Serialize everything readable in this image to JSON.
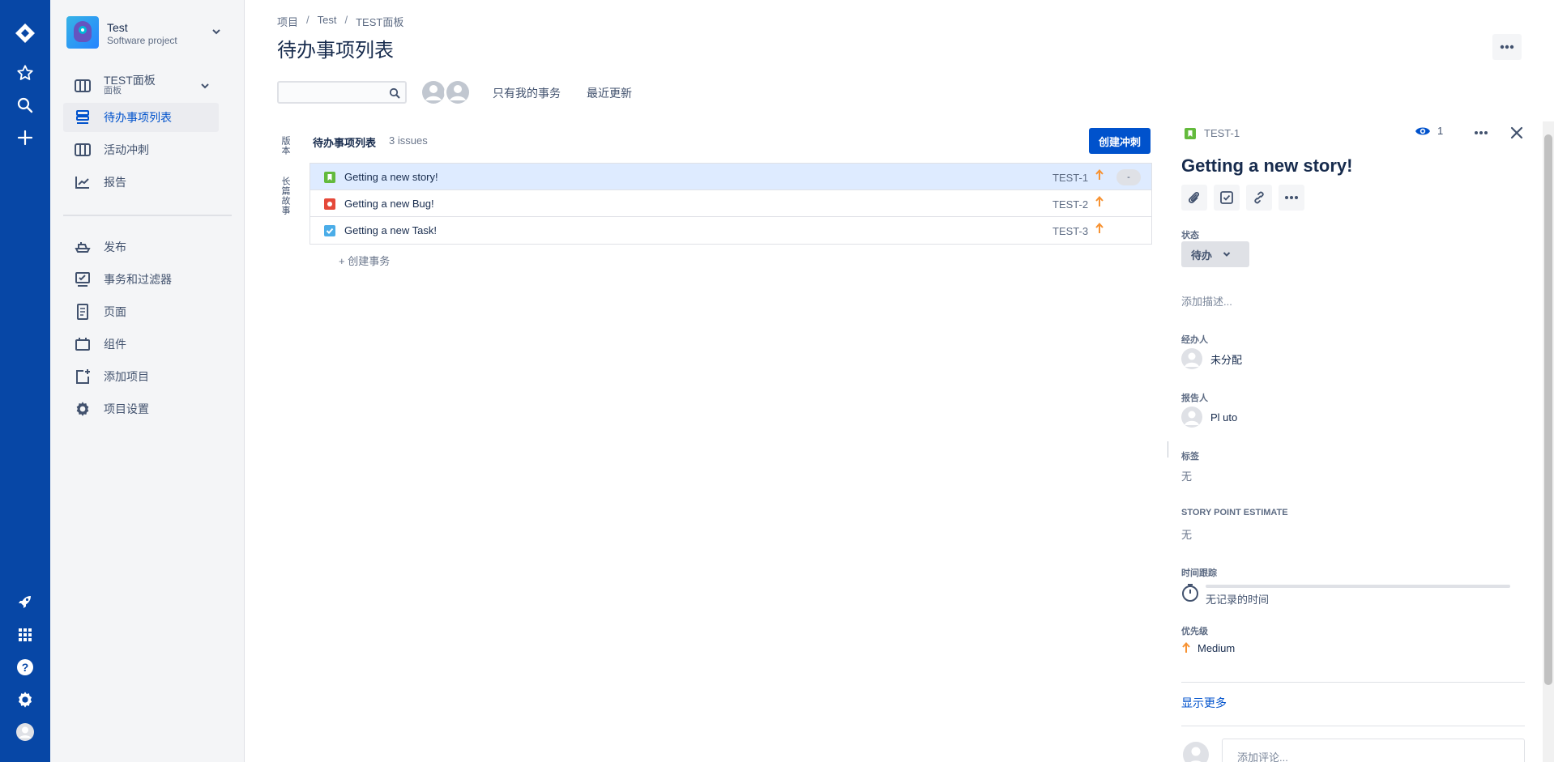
{
  "global_nav": {
    "icons": [
      "jira-logo-icon",
      "star-icon",
      "search-icon",
      "plus-icon",
      "rocket-icon",
      "app-switcher-icon",
      "help-icon",
      "settings-icon",
      "profile-icon"
    ]
  },
  "project": {
    "name": "Test",
    "type": "Software project"
  },
  "sidebar": {
    "board": {
      "label": "TEST面板",
      "sub": "面板"
    },
    "items": [
      {
        "label": "待办事项列表"
      },
      {
        "label": "活动冲刺"
      },
      {
        "label": "报告"
      },
      {
        "label": "发布"
      },
      {
        "label": "事务和过滤器"
      },
      {
        "label": "页面"
      },
      {
        "label": "组件"
      },
      {
        "label": "添加项目"
      },
      {
        "label": "项目设置"
      }
    ]
  },
  "breadcrumbs": [
    "项目",
    "Test",
    "TEST面板"
  ],
  "page_title": "待办事项列表",
  "filters": {
    "my_issues": "只有我的事务",
    "recently_updated": "最近更新"
  },
  "side_tabs": [
    "版本",
    "长篇故事"
  ],
  "backlog": {
    "title": "待办事项列表",
    "count": "3 issues",
    "create_sprint": "创建冲刺",
    "create_issue": "+ 创建事务",
    "issues": [
      {
        "type": "story",
        "summary": "Getting a new story!",
        "key": "TEST-1",
        "estimate": "-"
      },
      {
        "type": "bug",
        "summary": "Getting a new Bug!",
        "key": "TEST-2"
      },
      {
        "type": "task",
        "summary": "Getting a new Task!",
        "key": "TEST-3"
      }
    ]
  },
  "colors": {
    "nav_blue": "#0747a6",
    "primary": "#0052cc",
    "story": "#63ba3c",
    "bug": "#e5493a",
    "task": "#4bade8",
    "priority_medium": "#f79232",
    "selected_row": "#deebff"
  },
  "detail": {
    "key": "TEST-1",
    "watch_count": "1",
    "title": "Getting a new story!",
    "status_label": "状态",
    "status": "待办",
    "description_placeholder": "添加描述...",
    "assignee_label": "经办人",
    "assignee": "未分配",
    "reporter_label": "报告人",
    "reporter": "Pl uto",
    "labels_label": "标签",
    "labels_value": "无",
    "story_points_label": "STORY POINT ESTIMATE",
    "story_points_value": "无",
    "time_tracking_label": "时间跟踪",
    "time_tracking_value": "无记录的时间",
    "priority_label": "优先级",
    "priority": "Medium",
    "show_more": "显示更多",
    "comment_placeholder": "添加评论..."
  }
}
